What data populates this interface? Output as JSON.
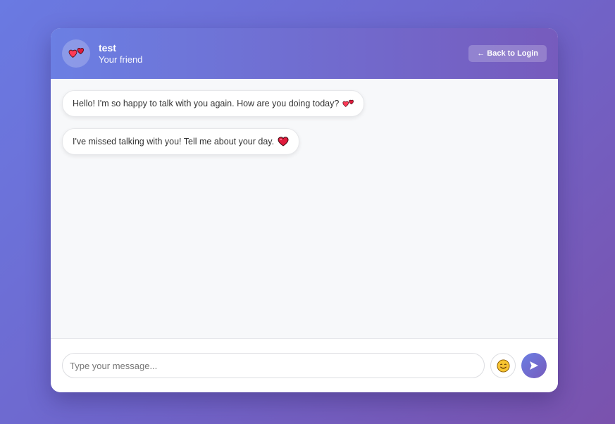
{
  "header": {
    "avatar_icon": "two-hearts-icon",
    "name": "test",
    "subtitle": "Your friend",
    "back_button_label": "← Back to Login"
  },
  "messages": [
    {
      "text": "Hello! I'm so happy to talk with you again. How are you doing today?",
      "icon": "two-hearts-icon"
    },
    {
      "text": "I've missed talking with you! Tell me about your day.",
      "icon": "red-heart-icon"
    }
  ],
  "composer": {
    "placeholder": "Type your message...",
    "emoji_icon": "smiling-face-icon",
    "send_icon": "send-arrow-icon"
  },
  "colors": {
    "accent_start": "#6b7fe3",
    "accent_end": "#765bbd",
    "heart_red": "#e01b3c"
  }
}
